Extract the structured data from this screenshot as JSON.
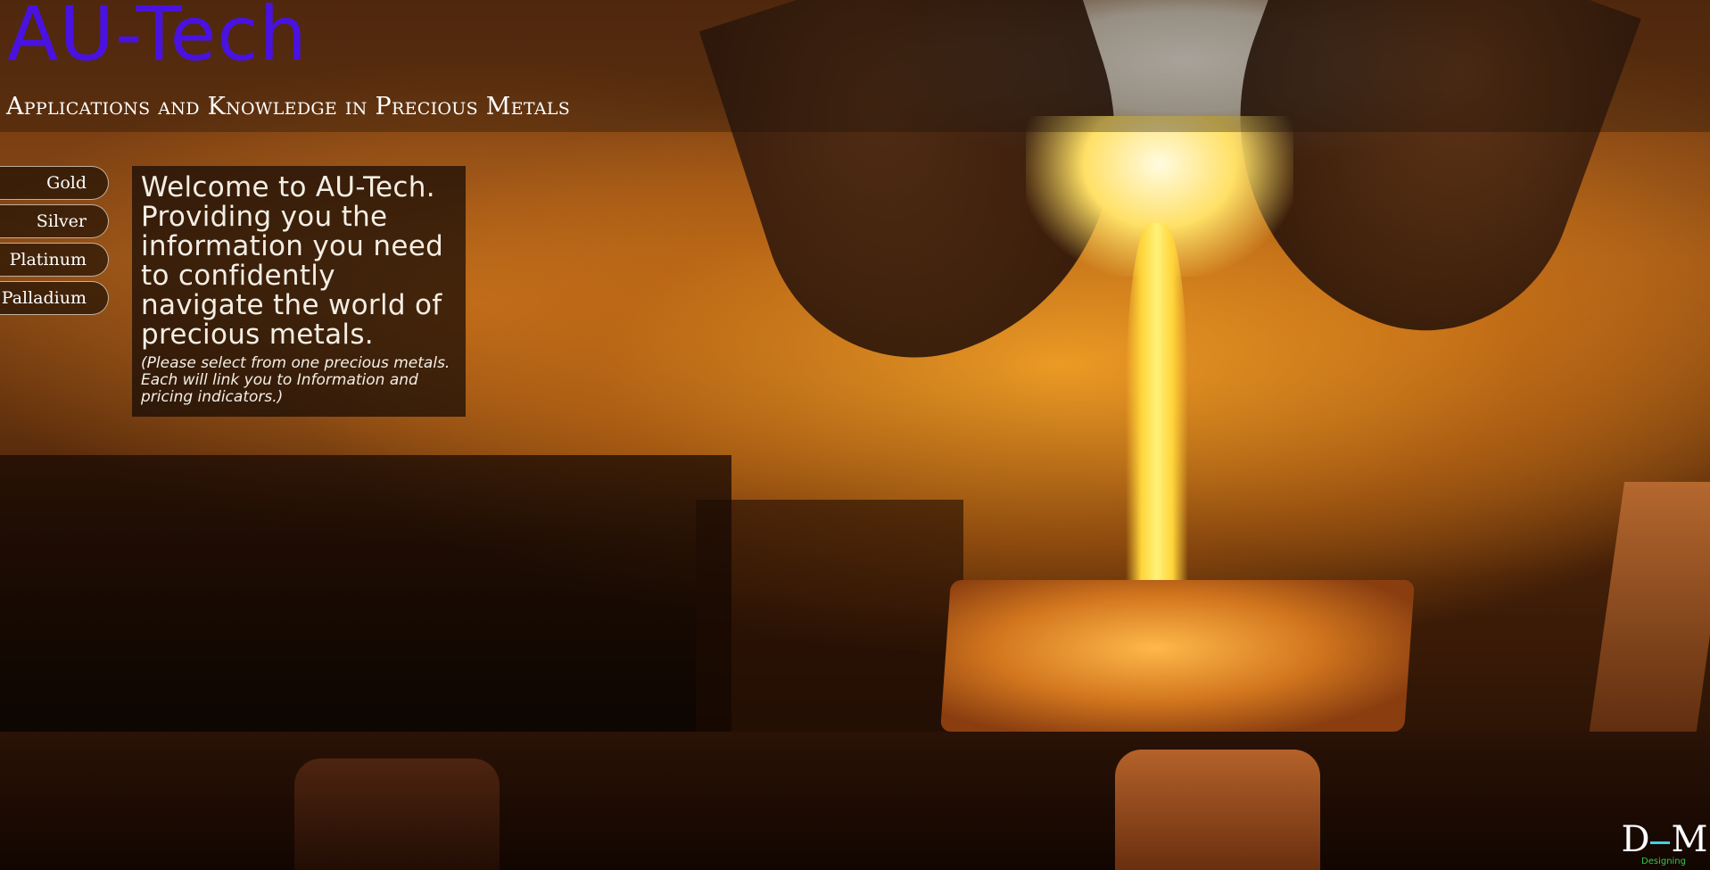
{
  "header": {
    "title": "AU-Tech",
    "tagline": "Applications and Knowledge in Precious Metals"
  },
  "nav": {
    "items": [
      {
        "label": "Gold"
      },
      {
        "label": "Silver"
      },
      {
        "label": "Platinum"
      },
      {
        "label": "Palladium"
      }
    ]
  },
  "welcome": {
    "heading": "Welcome to AU-Tech. Providing you the information you need to confidently navigate the world of precious metals.",
    "note": "(Please select from one precious metals. Each will link you to Information and pricing indicators.)"
  },
  "logo": {
    "mark": "DM",
    "sub": "Designing"
  },
  "colors": {
    "title": "#4a12e0",
    "logo_bar": "#3fd3d8",
    "logo_sub": "#35c84b"
  },
  "background": {
    "subject": "molten gold being poured from a ladle into an ingot mold"
  }
}
